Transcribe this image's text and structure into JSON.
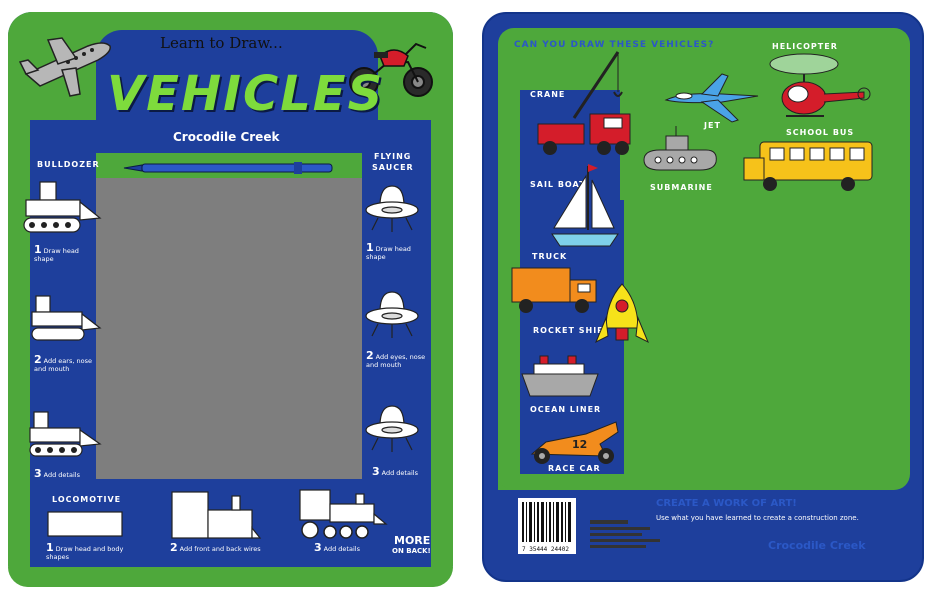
{
  "front": {
    "kicker": "Learn to Draw...",
    "title": "VEHICLES",
    "brand": "Crocodile Creek",
    "bulldozer": {
      "label": "BULLDOZER",
      "steps": [
        "Draw head shape",
        "Add ears, nose and mouth",
        "Add details"
      ]
    },
    "saucer": {
      "label_line1": "FLYING",
      "label_line2": "SAUCER",
      "steps": [
        "Draw head shape",
        "Add eyes, nose and mouth",
        "Add details"
      ]
    },
    "locomotive": {
      "label": "LOCOMOTIVE",
      "steps": [
        "Draw head and body shapes",
        "Add front and back wires",
        "Add details"
      ]
    },
    "step_numbers": [
      "1",
      "2",
      "3"
    ],
    "more": "MORE",
    "more_sub": "ON BACK!"
  },
  "back": {
    "heading": "CAN YOU DRAW THESE VEHICLES?",
    "vehicles": {
      "crane": "CRANE",
      "jet": "JET",
      "helicopter": "HELICOPTER",
      "school_bus": "SCHOOL BUS",
      "sail_boat": "SAIL BOAT",
      "submarine": "SUBMARINE",
      "truck": "TRUCK",
      "rocket_ship": "ROCKET SHIP",
      "ocean_liner": "OCEAN LINER",
      "race_car": "RACE CAR"
    },
    "race_number": "12",
    "cta_title": "CREATE A WORK OF ART!",
    "cta_body": "Use what you have learned to create a construction zone.",
    "brand": "Crocodile Creek",
    "barcode_number": "7  35444  24402"
  },
  "colors": {
    "blue": "#1e3f9c",
    "green": "#4ea83b",
    "title_green": "#7edb3c",
    "screen_gray": "#7e7e7e"
  }
}
